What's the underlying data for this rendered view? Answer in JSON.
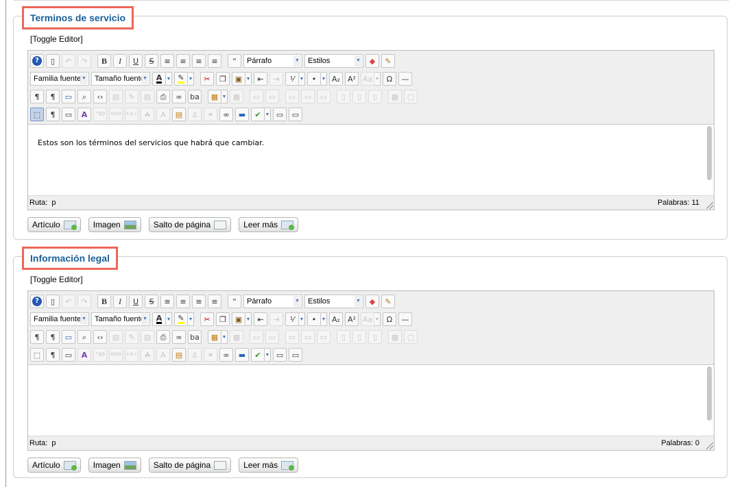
{
  "sections": [
    {
      "legend": "Terminos de servicio",
      "toggle": "[Toggle Editor]",
      "toolbar": {
        "format_select": "Párrafo",
        "styles_select": "Estilos",
        "font_family_select": "Familia fuente",
        "font_size_select": "Tamaño fuente"
      },
      "content": "Estos son los términos del servicios que habrá que cambiar.",
      "path_label": "Ruta:",
      "path_value": "p",
      "word_count": "Palabras: 11",
      "buttons": {
        "article": "Artículo",
        "image": "Imagen",
        "page_break": "Salto de página",
        "read_more": "Leer más"
      }
    },
    {
      "legend": "Información legal",
      "toggle": "[Toggle Editor]",
      "toolbar": {
        "format_select": "Párrafo",
        "styles_select": "Estilos",
        "font_family_select": "Familia fuente",
        "font_size_select": "Tamaño fuente"
      },
      "content": "",
      "path_label": "Ruta:",
      "path_value": "p",
      "word_count": "Palabras: 0",
      "buttons": {
        "article": "Artículo",
        "image": "Imagen",
        "page_break": "Salto de página",
        "read_more": "Leer más"
      }
    }
  ],
  "colors": {
    "legend_text": "#1b5f98",
    "highlight_border": "#ec6759"
  }
}
